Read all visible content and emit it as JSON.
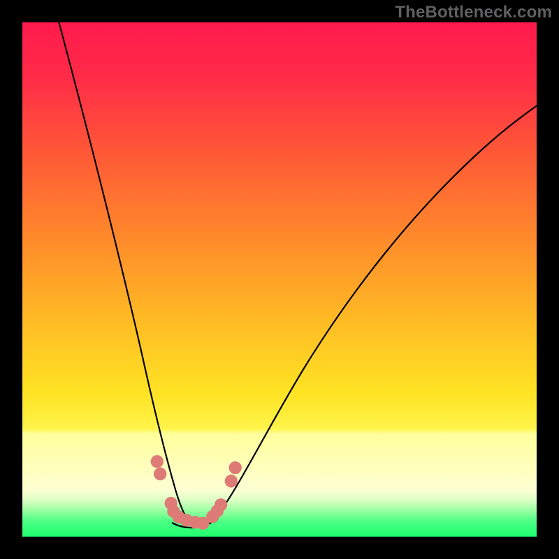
{
  "watermark": "TheBottleneck.com",
  "colors": {
    "gradient_top": "#ff1a4d",
    "gradient_mid_upper": "#ff7a2e",
    "gradient_mid": "#ffd624",
    "gradient_pale_band_top": "#ffff9b",
    "gradient_pale_band_bottom": "#fdffd4",
    "gradient_bottom": "#1eff6f",
    "curve": "#000000",
    "marker": "#df7b76",
    "frame": "#000000"
  },
  "chart_data": {
    "type": "line",
    "title": "",
    "xlabel": "",
    "ylabel": "",
    "x_range": [
      0,
      100
    ],
    "y_range_percent_from_top": [
      0,
      100
    ],
    "note": "No numeric axis ticks are visible; positions are given in percent of plot width (x) and percent of plot height from the top (y). Lower y (nearer 100) is the green 'good' zone at the bottom.",
    "series": [
      {
        "name": "left-branch",
        "x_percent": [
          7,
          10,
          14,
          18,
          21,
          24,
          26,
          28,
          29.5,
          30.5
        ],
        "y_percent_from_top": [
          0,
          16,
          35,
          54,
          68,
          79,
          86,
          91,
          94.5,
          96.5
        ]
      },
      {
        "name": "right-branch",
        "x_percent": [
          38,
          40,
          44,
          50,
          58,
          66,
          74,
          82,
          90,
          100
        ],
        "y_percent_from_top": [
          96,
          92,
          83,
          71,
          57,
          45,
          35,
          26,
          20,
          15
        ]
      }
    ],
    "markers": {
      "name": "highlighted-points",
      "shape": "circle",
      "color": "#df7b76",
      "radius_percent": 1.25,
      "points_percent": [
        {
          "x": 26.2,
          "y": 85.4
        },
        {
          "x": 26.8,
          "y": 87.8
        },
        {
          "x": 28.9,
          "y": 93.5
        },
        {
          "x": 29.4,
          "y": 95.1
        },
        {
          "x": 30.4,
          "y": 96.2
        },
        {
          "x": 31.9,
          "y": 96.8
        },
        {
          "x": 33.6,
          "y": 97.2
        },
        {
          "x": 35.1,
          "y": 97.4
        },
        {
          "x": 37.0,
          "y": 96.1
        },
        {
          "x": 37.9,
          "y": 95.0
        },
        {
          "x": 38.6,
          "y": 93.8
        },
        {
          "x": 40.6,
          "y": 89.2
        },
        {
          "x": 41.4,
          "y": 86.6
        }
      ]
    },
    "gradient_bands_percent_from_top": {
      "red_to_orange": [
        0,
        42
      ],
      "orange_to_yellow": [
        42,
        72
      ],
      "pale_yellow_band": [
        79,
        91
      ],
      "green": [
        95,
        100
      ]
    }
  }
}
